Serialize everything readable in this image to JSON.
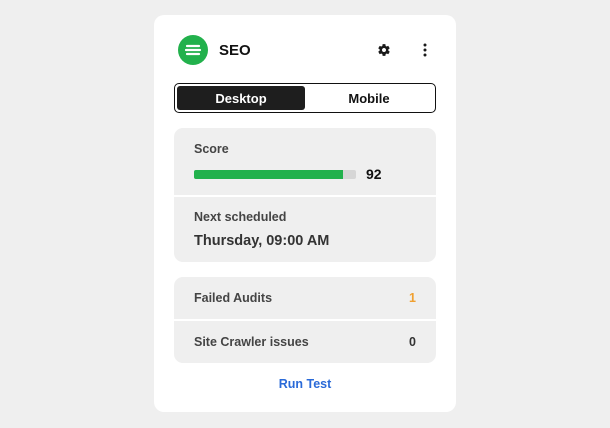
{
  "header": {
    "title": "SEO",
    "logo_icon": "seo-logo-icon",
    "settings_icon": "gear-icon",
    "menu_icon": "kebab-menu-icon"
  },
  "toggle": {
    "options": [
      "Desktop",
      "Mobile"
    ],
    "selected": "Desktop"
  },
  "score": {
    "label": "Score",
    "value": "92",
    "progress_percent": 92
  },
  "schedule": {
    "label": "Next scheduled",
    "value": "Thursday, 09:00 AM"
  },
  "stats": [
    {
      "label": "Failed Audits",
      "value": "1",
      "color": "#f0a030"
    },
    {
      "label": "Site Crawler issues",
      "value": "0",
      "color": "#333333"
    }
  ],
  "actions": {
    "run_label": "Run Test"
  },
  "colors": {
    "brand": "#22b14c",
    "link": "#2a6ad8",
    "toggle_active": "#1e1e1e"
  }
}
